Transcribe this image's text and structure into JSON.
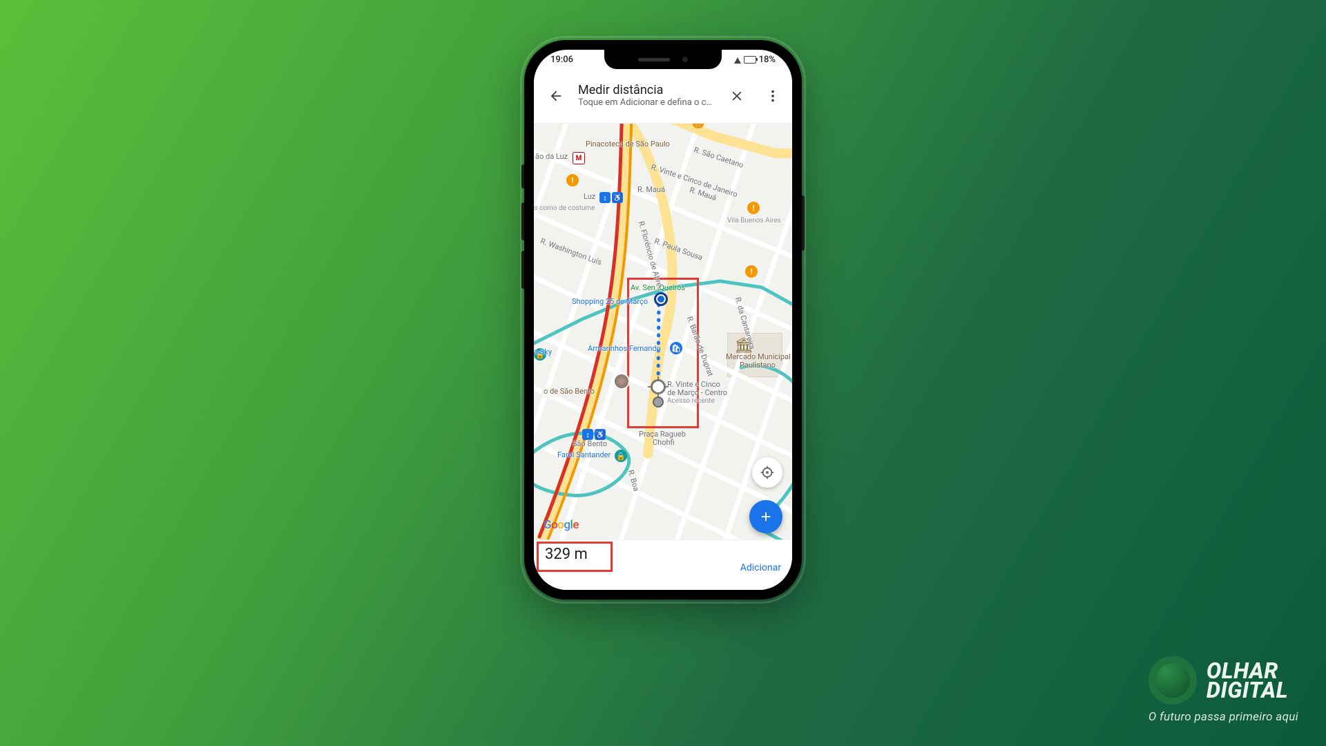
{
  "statusbar": {
    "time": "19:06",
    "battery": "18%"
  },
  "header": {
    "title": "Medir distância",
    "subtitle": "Toque em Adicionar e defina o ca..."
  },
  "bottom": {
    "distance": "329 m",
    "add_label": "Adicionar"
  },
  "watermark": {
    "line1": "OLHAR",
    "line2": "DIGITAL",
    "tagline": "O futuro passa primeiro aqui"
  },
  "map": {
    "attribution": "Google",
    "labels": {
      "pinacoteca": "Pinacoteca de São Paulo",
      "sao_caetano": "R. São Caetano",
      "vinte_cinco_jan": "R. Vinte e Cinco de Janeiro",
      "maua1": "R. Mauá",
      "maua2": "R. Mauá",
      "ao_da_luz": "ão da Luz",
      "luz": "Luz",
      "como_costume": "o como de costume",
      "florencio": "R. Florêncio de Abreu",
      "washington": "R. Washington Luís",
      "paula_sousa": "R. Paula Sousa",
      "vila_buenos": "Vila Buenos Aires",
      "sen_queiros": "Av. Sen. Queirós",
      "shopping25": "Shopping 25 de Março",
      "armarinhos": "Armarinhos Fernando",
      "barao_duprat": "R. Barão de Duprat",
      "cantareira": "R. da Cantareira",
      "mercado1": "Mercado Municipal",
      "mercado2": "Paulistano",
      "vinte_cinco_marco1": "R. Vinte e Cinco",
      "vinte_cinco_marco2": "de Março - Centro",
      "vinte_cinco_marco3": "Acesso recente",
      "sao_bento_st": "o de São Bento",
      "sao_bento": "São Bento",
      "farol": "Farol Santander",
      "praca1": "Praça Ragueb",
      "praca2": "Chohfi",
      "boa": "R. Boa",
      "sky": "a Sky"
    }
  }
}
